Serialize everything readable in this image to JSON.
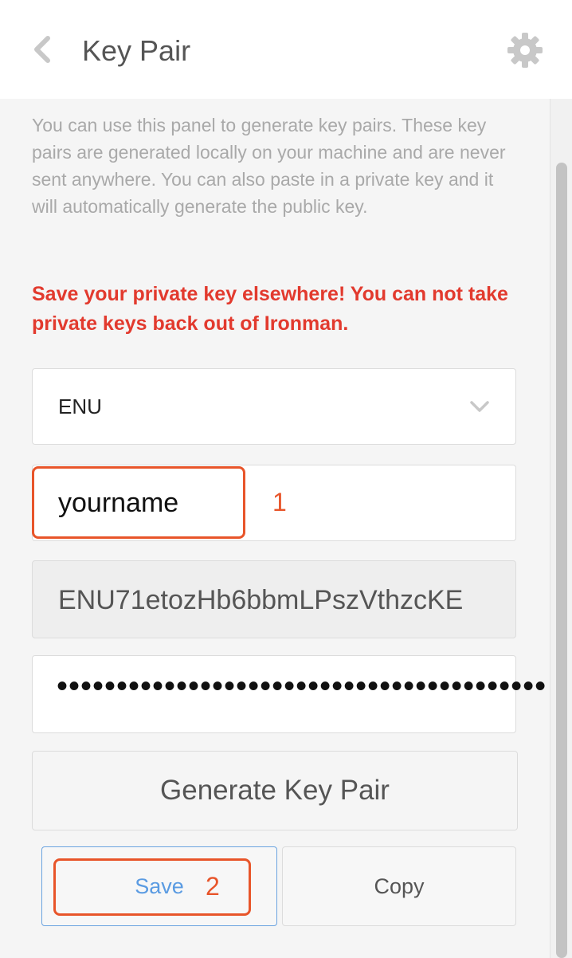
{
  "header": {
    "title": "Key Pair",
    "back_icon": "chevron-left-icon",
    "settings_icon": "gear-icon"
  },
  "intro_text": "You can use this panel to generate key pairs. These key pairs are generated locally on your machine and are never sent anywhere. You can also paste in a private key and it will automatically generate the public key.",
  "warning_text": "Save your private key elsewhere! You can not take private keys back out of Ironman.",
  "form": {
    "network_select": {
      "value": "ENU",
      "icon": "chevron-down-icon"
    },
    "name_input": {
      "value": "yourname"
    },
    "public_key": {
      "value": "ENU71etozHb6bbmLPszVthzcKE"
    },
    "private_key": {
      "value": "•••••••••••••••••••••••••••••••••••••••••"
    }
  },
  "buttons": {
    "generate": "Generate Key Pair",
    "save": "Save",
    "copy": "Copy"
  },
  "annotations": {
    "step1": "1",
    "step2": "2"
  },
  "colors": {
    "warning": "#e23a2e",
    "annotation": "#e8552a",
    "save_accent": "#5a9be2"
  }
}
